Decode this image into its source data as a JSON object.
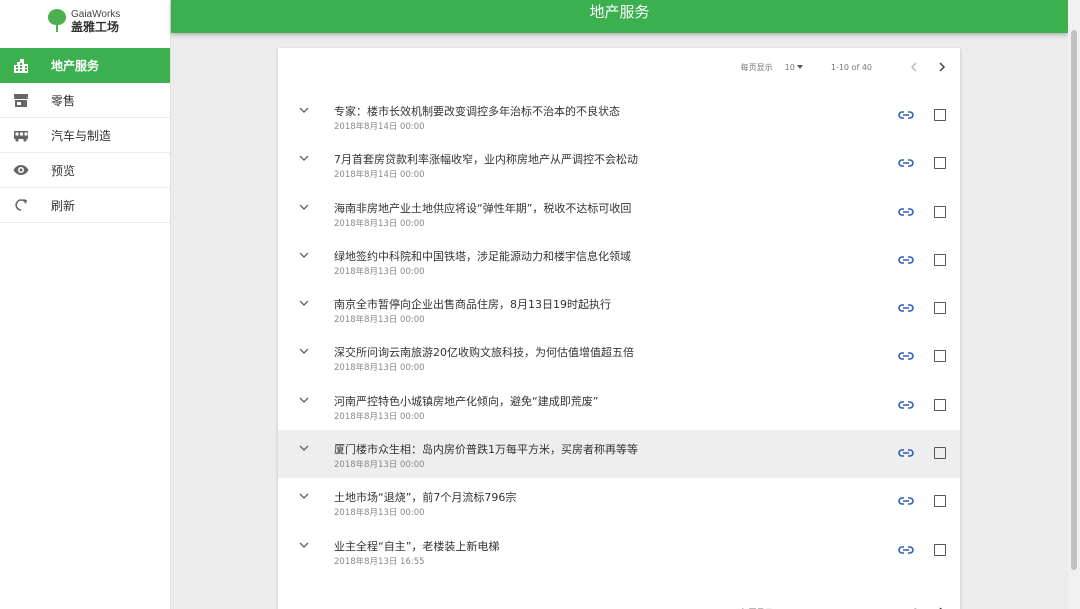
{
  "app": {
    "logo_en": "GaiaWorks",
    "logo_cn": "盖雅工场",
    "accent_color": "#3cb04f"
  },
  "sidebar": {
    "items": [
      {
        "label": "地产服务",
        "icon": "building-icon",
        "active": true
      },
      {
        "label": "零售",
        "icon": "store-icon",
        "active": false
      },
      {
        "label": "汽车与制造",
        "icon": "bus-icon",
        "active": false
      },
      {
        "label": "预览",
        "icon": "eye-icon",
        "active": false
      },
      {
        "label": "刷新",
        "icon": "refresh-icon",
        "active": false
      }
    ]
  },
  "header": {
    "title": "地产服务"
  },
  "pagination": {
    "rows_per_page_label": "每页显示",
    "rows_per_page_value": "10",
    "range": "1-10 of 40"
  },
  "articles": [
    {
      "title": "专家：楼市长效机制要改变调控多年治标不治本的不良状态",
      "date": "2018年8月14日 00:00"
    },
    {
      "title": "7月首套房贷款利率涨幅收窄，业内称房地产从严调控不会松动",
      "date": "2018年8月14日 00:00"
    },
    {
      "title": "海南非房地产业土地供应将设“弹性年期”，税收不达标可收回",
      "date": "2018年8月13日 00:00"
    },
    {
      "title": "绿地签约中科院和中国铁塔，涉足能源动力和楼宇信息化领域",
      "date": "2018年8月13日 00:00"
    },
    {
      "title": "南京全市暂停向企业出售商品住房，8月13日19时起执行",
      "date": "2018年8月13日 00:00"
    },
    {
      "title": "深交所问询云南旅游20亿收购文旅科技，为何估值增值超五倍",
      "date": "2018年8月13日 00:00"
    },
    {
      "title": "河南严控特色小城镇房地产化倾向，避免“建成即荒废”",
      "date": "2018年8月13日 00:00"
    },
    {
      "title": "厦门楼市众生相：岛内房价普跌1万每平方米，买房者称再等等",
      "date": "2018年8月13日 00:00",
      "highlighted": true
    },
    {
      "title": "土地市场“退烧”，前7个月流标796宗",
      "date": "2018年8月13日 00:00"
    },
    {
      "title": "业主全程“自主”，老楼装上新电梯",
      "date": "2018年8月13日 16:55"
    }
  ]
}
